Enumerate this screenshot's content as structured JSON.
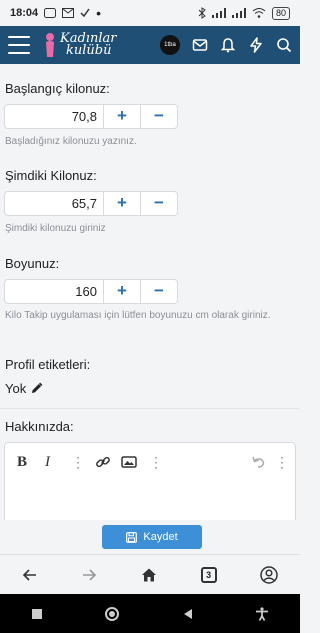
{
  "status_bar": {
    "time": "18:04",
    "battery": "80"
  },
  "header": {
    "logo_text_line1": "Kadınlar",
    "logo_text_line2": "kulübü",
    "avatar_text": "1tba"
  },
  "form": {
    "start_weight": {
      "label": "Başlangıç kilonuz:",
      "value": "70,8",
      "hint": "Başladığınız kilonuzu yazınız."
    },
    "current_weight": {
      "label": "Şimdiki Kilonuz:",
      "value": "65,7",
      "hint": "Şimdiki kilonuzu giriniz"
    },
    "height": {
      "label": "Boyunuz:",
      "value": "160",
      "hint": "Kilo Takip uygulaması için lütfen boyunuzu cm olarak giriniz."
    },
    "profile_tags": {
      "label": "Profil etiketleri:",
      "value": "Yok"
    },
    "about": {
      "label": "Hakkınızda:"
    },
    "plus_symbol": "+",
    "minus_symbol": "−"
  },
  "save_button": {
    "label": "Kaydet"
  },
  "browser": {
    "tab_count": "3"
  },
  "colors": {
    "header_bg": "#1f4f74",
    "accent": "#2b6fb0",
    "save_bg": "#3d8fd8"
  }
}
